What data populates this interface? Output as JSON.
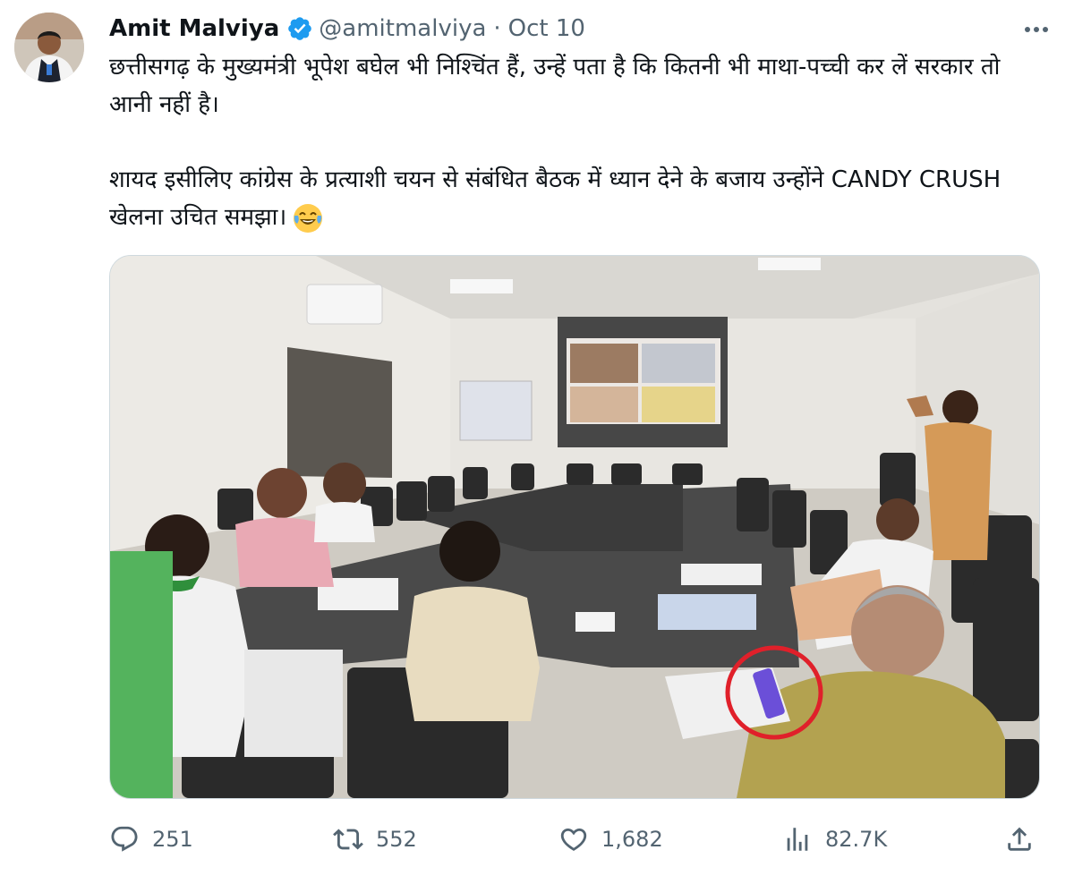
{
  "author": {
    "name": "Amit Malviya",
    "handle": "@amitmalviya",
    "separator": "·",
    "date": "Oct 10"
  },
  "tweet": {
    "paragraph1": "छत्तीसगढ़ के मुख्यमंत्री भूपेश बघेल भी निश्चिंत हैं, उन्हें पता है कि कितनी भी माथा-पच्ची कर लें सरकार तो आनी नहीं है।",
    "paragraph2": "शायद इसीलिए कांग्रेस के प्रत्याशी चयन से संबंधित बैठक में ध्यान देने के बजाय उन्होंने CANDY CRUSH खेलना उचित समझा।",
    "emoji": "face-with-tears-of-joy"
  },
  "icons": {
    "verified": "verified-badge-icon",
    "more": "more-icon",
    "reply": "reply-icon",
    "retweet": "retweet-icon",
    "like": "like-icon",
    "views": "views-icon",
    "share": "share-icon"
  },
  "actions": {
    "replies": "251",
    "retweets": "552",
    "likes": "1,682",
    "views": "82.7K"
  },
  "colors": {
    "verified": "#1d9bf0",
    "secondary_text": "#536471",
    "primary_text": "#0f1419",
    "highlight_circle": "#e0202a"
  }
}
